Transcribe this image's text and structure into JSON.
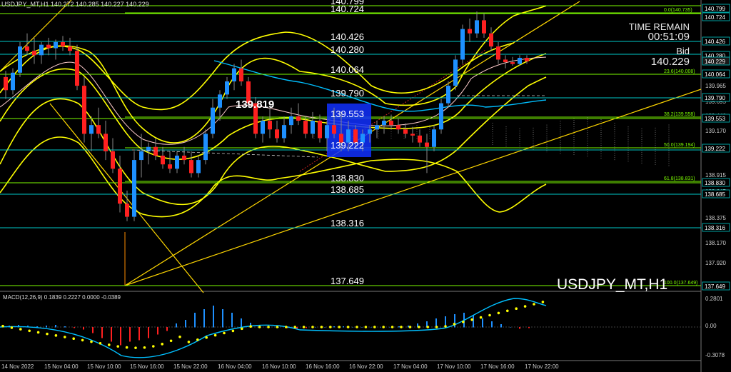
{
  "window": {
    "header": "USDJPY_MT,H1  140.272 140.285 140.227 140.229",
    "symbol_label": "USDJPY_MT,H1"
  },
  "info_panel": {
    "time_remain_label": "TIME REMAIN",
    "time_remain": "00:51:09",
    "bid_label": "Bid",
    "bid": "140.229"
  },
  "annotations": {
    "high_label": "139.819"
  },
  "level_labels": [
    "140.799",
    "140.724",
    "140.426",
    "140.280",
    "140.064",
    "139.790",
    "139.553",
    "139.222",
    "138.830",
    "138.685",
    "138.316",
    "137.649"
  ],
  "fib_labels": [
    "0.0(140.735)",
    "23.6(140.008)",
    "38.2(139.558)",
    "50.0(139.194)",
    "61.8(138.831)",
    "100.0(137.649)"
  ],
  "price_axis": {
    "ticks": [
      "139.965",
      "139.695",
      "139.440",
      "139.170",
      "138.915",
      "138.645",
      "138.375",
      "138.170",
      "137.920",
      "137.650"
    ],
    "boxed": [
      "140.799",
      "140.724",
      "140.426",
      "140.280",
      "140.229",
      "140.064",
      "139.790",
      "139.553",
      "139.222",
      "138.830",
      "138.685",
      "138.316",
      "137.649"
    ]
  },
  "macd": {
    "label": "MACD(12,26,9) 0.1839 0.2227 0.0000 -0.0389",
    "ticks": [
      "0.2801",
      "0.00",
      "-0.3078"
    ]
  },
  "time_axis": [
    "14 Nov 2022",
    "15 Nov 04:00",
    "15 Nov 10:00",
    "15 Nov 16:00",
    "15 Nov 22:00",
    "16 Nov 04:00",
    "16 Nov 10:00",
    "16 Nov 16:00",
    "16 Nov 22:00",
    "17 Nov 04:00",
    "17 Nov 10:00",
    "17 Nov 16:00",
    "17 Nov 22:00"
  ],
  "colors": {
    "bull": "#1e90ff",
    "bear": "#ff2020",
    "level_line": "#00c8c8",
    "fib_line": "#7cfc00",
    "bollinger": "#ffff00",
    "trend": "#ffd700"
  },
  "chart_data": {
    "type": "candlestick",
    "ohlc": [
      [
        140.05,
        140.12,
        139.8,
        139.9
      ],
      [
        139.9,
        140.15,
        139.85,
        140.1
      ],
      [
        140.1,
        140.45,
        140.05,
        140.4
      ],
      [
        140.4,
        140.55,
        140.3,
        140.35
      ],
      [
        140.35,
        140.5,
        140.2,
        140.3
      ],
      [
        140.3,
        140.45,
        140.2,
        140.42
      ],
      [
        140.42,
        140.5,
        140.3,
        140.38
      ],
      [
        140.38,
        140.48,
        140.25,
        140.45
      ],
      [
        140.45,
        140.52,
        140.35,
        140.4
      ],
      [
        140.4,
        140.5,
        140.3,
        140.35
      ],
      [
        140.35,
        140.42,
        139.9,
        139.95
      ],
      [
        139.95,
        140.05,
        139.3,
        139.4
      ],
      [
        139.4,
        139.6,
        139.2,
        139.5
      ],
      [
        139.5,
        139.7,
        139.35,
        139.4
      ],
      [
        139.4,
        139.55,
        139.1,
        139.2
      ],
      [
        139.2,
        139.35,
        138.95,
        139.0
      ],
      [
        139.0,
        139.15,
        138.5,
        138.6
      ],
      [
        138.6,
        138.75,
        138.4,
        138.45
      ],
      [
        138.45,
        139.2,
        138.4,
        139.1
      ],
      [
        139.1,
        139.4,
        138.9,
        139.2
      ],
      [
        139.2,
        139.3,
        139.05,
        139.25
      ],
      [
        139.25,
        139.35,
        139.1,
        139.15
      ],
      [
        139.15,
        139.25,
        139.0,
        139.05
      ],
      [
        139.05,
        139.2,
        138.95,
        139.0
      ],
      [
        139.0,
        139.2,
        138.95,
        139.15
      ],
      [
        139.15,
        139.25,
        139.05,
        139.1
      ],
      [
        139.1,
        139.2,
        138.9,
        138.95
      ],
      [
        138.95,
        139.15,
        138.9,
        139.1
      ],
      [
        139.1,
        139.45,
        139.05,
        139.4
      ],
      [
        139.4,
        139.8,
        139.35,
        139.7
      ],
      [
        139.7,
        139.9,
        139.55,
        139.85
      ],
      [
        139.85,
        140.05,
        139.8,
        140.0
      ],
      [
        140.0,
        140.2,
        139.9,
        140.15
      ],
      [
        140.15,
        140.25,
        139.95,
        140.0
      ],
      [
        140.0,
        140.05,
        139.7,
        139.75
      ],
      [
        139.75,
        139.82,
        139.35,
        139.4
      ],
      [
        139.4,
        139.6,
        139.3,
        139.55
      ],
      [
        139.55,
        139.7,
        139.35,
        139.45
      ],
      [
        139.45,
        139.55,
        139.3,
        139.35
      ],
      [
        139.35,
        139.6,
        139.3,
        139.5
      ],
      [
        139.5,
        139.7,
        139.4,
        139.6
      ],
      [
        139.6,
        139.75,
        139.5,
        139.55
      ],
      [
        139.55,
        139.6,
        139.35,
        139.4
      ],
      [
        139.4,
        139.65,
        139.35,
        139.55
      ],
      [
        139.55,
        139.62,
        139.3,
        139.35
      ],
      [
        139.35,
        139.55,
        139.2,
        139.5
      ],
      [
        139.5,
        139.7,
        139.35,
        139.4
      ],
      [
        139.4,
        139.65,
        139.2,
        139.3
      ],
      [
        139.3,
        139.55,
        139.2,
        139.45
      ],
      [
        139.45,
        139.5,
        139.25,
        139.3
      ],
      [
        139.3,
        139.45,
        139.2,
        139.4
      ],
      [
        139.4,
        139.5,
        139.3,
        139.45
      ],
      [
        139.45,
        139.55,
        139.35,
        139.5
      ],
      [
        139.5,
        139.6,
        139.4,
        139.55
      ],
      [
        139.55,
        139.62,
        139.45,
        139.5
      ],
      [
        139.5,
        139.58,
        139.4,
        139.45
      ],
      [
        139.45,
        139.52,
        139.35,
        139.4
      ],
      [
        139.4,
        139.48,
        139.3,
        139.38
      ],
      [
        139.38,
        139.45,
        139.25,
        139.3
      ],
      [
        139.3,
        139.4,
        138.95,
        139.25
      ],
      [
        139.25,
        139.5,
        139.2,
        139.45
      ],
      [
        139.45,
        139.8,
        139.4,
        139.75
      ],
      [
        139.75,
        140.0,
        139.7,
        139.95
      ],
      [
        139.95,
        140.3,
        139.9,
        140.25
      ],
      [
        140.25,
        140.65,
        140.2,
        140.6
      ],
      [
        140.6,
        140.72,
        140.45,
        140.55
      ],
      [
        140.55,
        140.8,
        140.5,
        140.7
      ],
      [
        140.7,
        140.78,
        140.5,
        140.55
      ],
      [
        140.55,
        140.62,
        140.35,
        140.4
      ],
      [
        140.4,
        140.45,
        140.2,
        140.25
      ],
      [
        140.25,
        140.3,
        140.15,
        140.22
      ],
      [
        140.22,
        140.28,
        140.18,
        140.2
      ],
      [
        140.2,
        140.3,
        140.18,
        140.27
      ],
      [
        140.27,
        140.3,
        140.2,
        140.23
      ]
    ]
  }
}
